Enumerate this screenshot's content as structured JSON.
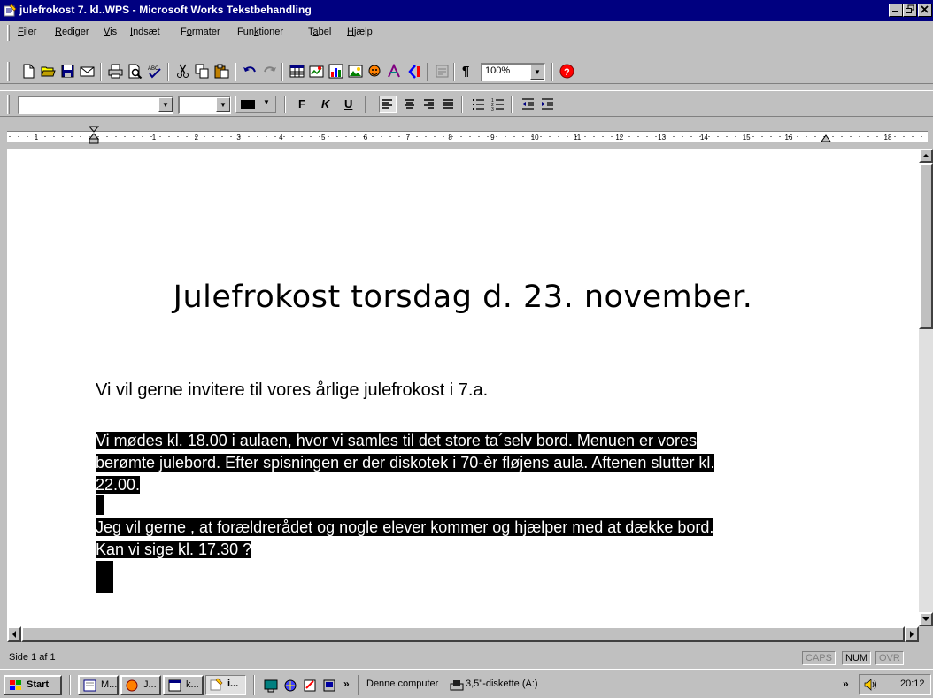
{
  "window": {
    "title": "julefrokost 7. kl..WPS - Microsoft Works Tekstbehandling",
    "caption_buttons": [
      "minimize",
      "restore",
      "close"
    ]
  },
  "menu": {
    "items": [
      "Filer",
      "Rediger",
      "Vis",
      "Indsæt",
      "Formater",
      "Funktioner",
      "Tabel",
      "Hjælp"
    ]
  },
  "toolbar": {
    "zoom": "100%",
    "bold_label": "F",
    "italic_label": "K",
    "underline_label": "U",
    "pilcrow": "¶"
  },
  "format_bar": {
    "font_name": "",
    "font_size": ""
  },
  "ruler": {
    "labels": [
      "1",
      "1",
      "2",
      "3",
      "4",
      "5",
      "6",
      "7",
      "8",
      "9",
      "10",
      "11",
      "12",
      "13",
      "14",
      "15",
      "16",
      "18"
    ]
  },
  "document": {
    "title": "Julefrokost torsdag d. 23. november.",
    "intro": "Vi vil gerne invitere til vores årlige julefrokost i 7.a.",
    "selected_lines": [
      "Vi mødes kl. 18.00 i aulaen, hvor vi samles til det store ta´selv bord. Menuen er vores ",
      "berømte julebord. Efter spisningen er der diskotek i 70-èr fløjens aula. Aftenen slutter kl.",
      "22.00. ",
      "",
      "Jeg vil gerne , at forældrerådet og nogle elever kommer og hjælper med at dække bord.",
      "Kan vi sige kl. 17.30 ? "
    ]
  },
  "status": {
    "page": "Side 1 af 1",
    "caps": "CAPS",
    "num": "NUM",
    "ovr": "OVR"
  },
  "taskbar": {
    "start": "Start",
    "tasks": [
      "M...",
      "J...",
      "k...",
      "i..."
    ],
    "chevron": "»",
    "folder1": "Denne computer",
    "folder2": "3,5\"-diskette (A:)",
    "tray_chevron": "»",
    "clock": "20:12"
  },
  "colors": {
    "titlebar": "#000080",
    "face": "#c0c0c0",
    "selection": "#000000"
  }
}
